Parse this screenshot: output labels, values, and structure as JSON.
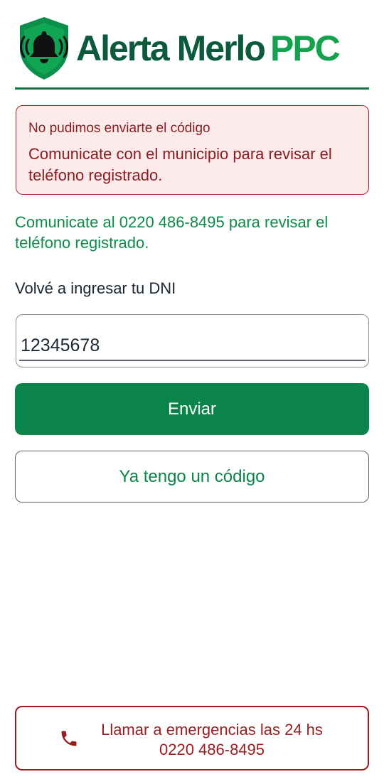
{
  "header": {
    "brand_name": "Alerta Merlo",
    "brand_suffix": "PPC"
  },
  "alert": {
    "title": "No pudimos enviarte el código",
    "body": "Comunicate con el municipio para revisar el teléfono registrado."
  },
  "info": {
    "text": "Comunicate al 0220 486-8495 para revisar el teléfono registrado."
  },
  "form": {
    "dni_label": "Volvé a ingresar tu DNI",
    "dni_value": "12345678"
  },
  "buttons": {
    "send_label": "Enviar",
    "have_code_label": "Ya tengo un código",
    "emergency_line1": "Llamar a emergencias las 24 hs",
    "emergency_line2": "0220 486-8495"
  },
  "colors": {
    "brand_dark_green": "#0c5a3c",
    "brand_green": "#12a34e",
    "primary_button": "#0a8448",
    "alert_background": "#fdebeb",
    "alert_text": "#8a1a1d",
    "emergency_red": "#9b1c20"
  },
  "icons": {
    "logo": "shield-bell-icon",
    "phone": "phone-icon"
  }
}
